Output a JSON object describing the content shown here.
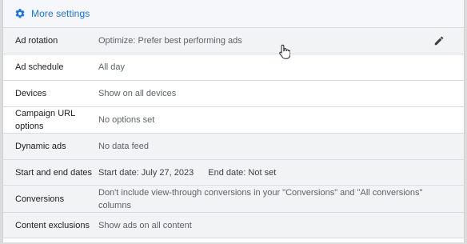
{
  "header": {
    "title": "More settings",
    "icon": "gear-icon"
  },
  "settings": [
    {
      "label": "Ad rotation",
      "value": "Optimize: Prefer best performing ads",
      "editable": true
    },
    {
      "label": "Ad schedule",
      "value": "All day"
    },
    {
      "label": "Devices",
      "value": "Show on all devices"
    },
    {
      "label": "Campaign URL options",
      "value": "No options set"
    },
    {
      "label": "Dynamic ads",
      "value": "No data feed"
    },
    {
      "label": "Start and end dates",
      "value": "Start date: July 27, 2023",
      "value2": "End date: Not set"
    },
    {
      "label": "Conversions",
      "value": "Don't include view-through conversions in your \"Conversions\" and \"All conversions\" columns"
    },
    {
      "label": "Content exclusions",
      "value": "Show ads on all content"
    }
  ],
  "colors": {
    "accent": "#1a73e8",
    "row_alt": "#f1f3f4",
    "label_text": "#202124",
    "value_text": "#5f6368"
  }
}
